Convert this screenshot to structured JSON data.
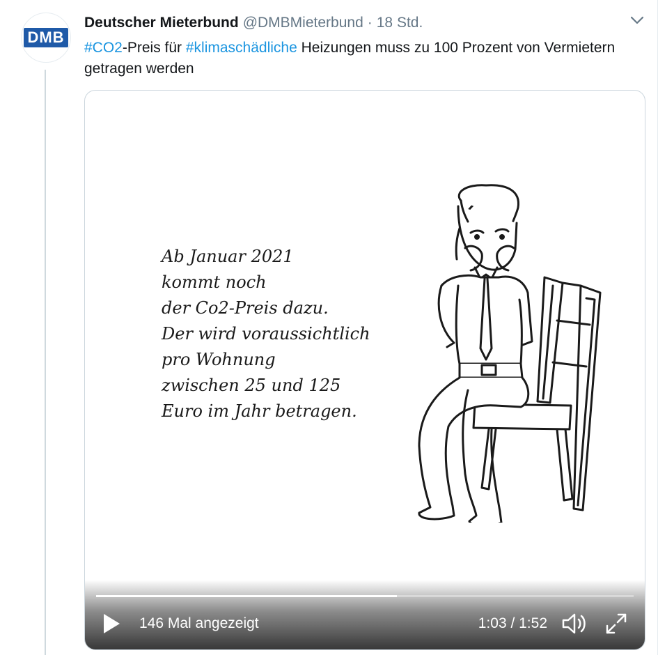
{
  "author": {
    "display_name": "Deutscher Mieterbund",
    "handle": "@DMBMieterbund",
    "separator": "·",
    "time": "18 Std.",
    "avatar_text": "DMB"
  },
  "tweet": {
    "hashtag_1": "#CO2",
    "text_1": "-Preis für ",
    "hashtag_2": "#klimaschädliche",
    "text_2": " Heizungen muss zu 100 Prozent von Vermietern getragen werden"
  },
  "video": {
    "overlay_lines": [
      "Ab Januar 2021",
      "kommt noch",
      "der Co2-Preis dazu.",
      "Der wird voraussichtlich",
      "pro Wohnung",
      "zwischen 25 und 125",
      "Euro im Jahr betragen."
    ],
    "views_label": "146 Mal angezeigt",
    "current_time": "1:03",
    "duration": "1:52",
    "time_display": "1:03 / 1:52",
    "progress_fraction": 0.56,
    "icons": {
      "play": "play-icon",
      "volume": "volume-icon",
      "fullscreen": "fullscreen-icon",
      "menu": "chevron-down-icon"
    }
  },
  "colors": {
    "link": "#1b95e0",
    "secondary_text": "#657786",
    "logo_blue": "#1f5aa8"
  }
}
